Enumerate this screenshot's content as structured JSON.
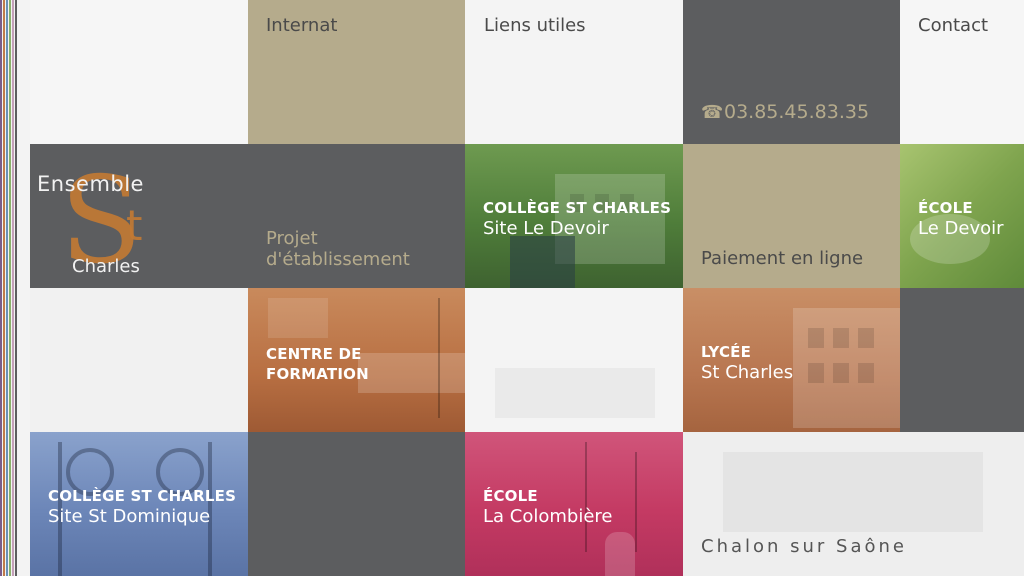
{
  "colors": {
    "dark": "#5c5d5f",
    "beige": "#b5ab8c",
    "light": "#f3f3f3",
    "orange": "#c07a4a",
    "green": "#5e8a46",
    "blue": "#6c86b8",
    "pink": "#c43a63",
    "logo_orange": "#c47a33"
  },
  "stripes": [
    "#7a5c8a",
    "#c07a4a",
    "#6a8fb8",
    "#8ab06a",
    "#c4a0b8",
    "#5c5d5f"
  ],
  "nav": {
    "internat": "Internat",
    "liens": "Liens utiles",
    "contact": "Contact",
    "phone_icon": "☎",
    "phone": "03.85.45.83.35"
  },
  "logo": {
    "ensemble": "Ensemble",
    "st": "St",
    "charles": "Charles"
  },
  "tiles": {
    "projet_line1": "Projet",
    "projet_line2": "d'établissement",
    "college_devoir": {
      "head": "COLLÈGE ST CHARLES",
      "sub": "Site Le Devoir"
    },
    "paiement": "Paiement en ligne",
    "ecole_devoir": {
      "head": "ÉCOLE",
      "sub": "Le Devoir"
    },
    "centre": {
      "head1": "CENTRE DE",
      "head2": "FORMATION"
    },
    "lycee": {
      "head": "LYCÉE",
      "sub": "St Charles"
    },
    "college_dominique": {
      "head": "COLLÈGE ST CHARLES",
      "sub": "Site St Dominique"
    },
    "ecole_colombiere": {
      "head": "ÉCOLE",
      "sub": "La Colombière"
    },
    "city": "Chalon sur Saône"
  }
}
